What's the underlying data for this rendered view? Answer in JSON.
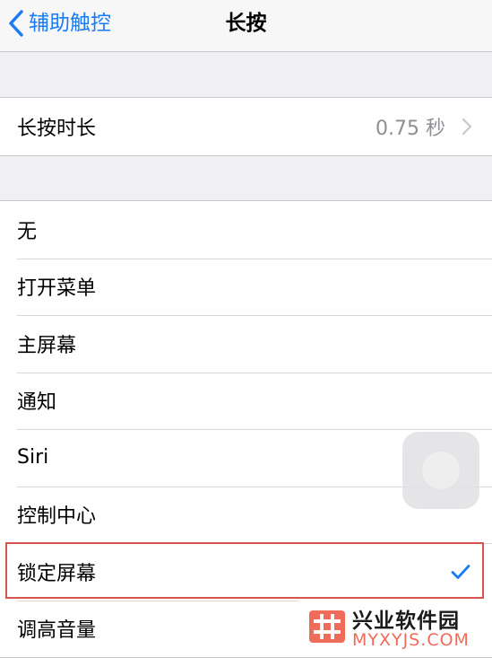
{
  "nav": {
    "back_label": "辅助触控",
    "title": "长按"
  },
  "duration": {
    "label": "长按时长",
    "value": "0.75 秒"
  },
  "actions": [
    {
      "label": "无",
      "selected": false
    },
    {
      "label": "打开菜单",
      "selected": false
    },
    {
      "label": "主屏幕",
      "selected": false
    },
    {
      "label": "通知",
      "selected": false
    },
    {
      "label": "Siri",
      "selected": false
    },
    {
      "label": "控制中心",
      "selected": false
    },
    {
      "label": "锁定屏幕",
      "selected": true
    },
    {
      "label": "调高音量",
      "selected": false
    }
  ],
  "watermark": {
    "title": "兴业软件园",
    "subtitle": "MYXYJS.COM"
  },
  "colors": {
    "accent": "#1a7cf5",
    "highlight": "#d9534f",
    "watermark_accent": "#ef6c5a"
  }
}
